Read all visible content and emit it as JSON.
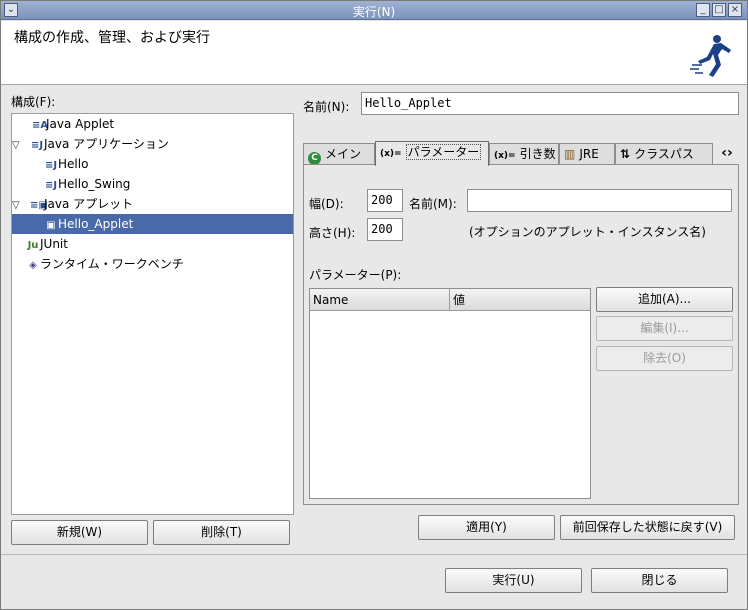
{
  "window": {
    "title": "実行(N)"
  },
  "banner": {
    "heading": "構成の作成、管理、および実行"
  },
  "left": {
    "config_label": "構成(F):",
    "tree": [
      {
        "label": "Java Applet",
        "icon": "applet-config-icon",
        "twisty": "",
        "indent": 0
      },
      {
        "label": "Java アプリケーション",
        "icon": "java-app-icon",
        "twisty": "▽",
        "indent": 0
      },
      {
        "label": "Hello",
        "icon": "java-class-icon",
        "twisty": "",
        "indent": 1
      },
      {
        "label": "Hello_Swing",
        "icon": "java-class-icon",
        "twisty": "",
        "indent": 1
      },
      {
        "label": "Java アプレット",
        "icon": "java-applet-icon",
        "twisty": "▽",
        "indent": 0
      },
      {
        "label": "Hello_Applet",
        "icon": "applet-icon",
        "twisty": "",
        "indent": 1,
        "selected": true
      },
      {
        "label": "JUnit",
        "icon": "junit-icon",
        "twisty": "",
        "indent": 0
      },
      {
        "label": "ランタイム・ワークベンチ",
        "icon": "workbench-icon",
        "twisty": "",
        "indent": 0
      }
    ],
    "new_button": "新規(W)",
    "delete_button": "削除(T)"
  },
  "right": {
    "name_label": "名前(N):",
    "name_value": "Hello_Applet",
    "tabs": [
      {
        "label": "メイン",
        "icon": "main-tab-icon",
        "glyph": "C"
      },
      {
        "label": "パラメーター",
        "icon": "parameters-tab-icon",
        "glyph": "(x)=",
        "active": true
      },
      {
        "label": "引き数",
        "icon": "arguments-tab-icon",
        "glyph": "(x)="
      },
      {
        "label": "JRE",
        "icon": "jre-tab-icon",
        "glyph": "▥"
      },
      {
        "label": "クラスパス",
        "icon": "classpath-tab-icon",
        "glyph": "⇅"
      }
    ],
    "tab_scroll": "‹›",
    "width_label": "幅(D):",
    "width_value": "200",
    "applet_name_label": "名前(M):",
    "applet_name_value": "",
    "height_label": "高さ(H):",
    "height_value": "200",
    "hint": "(オプションのアプレット・インスタンス名)",
    "params_label": "パラメーター(P):",
    "columns": [
      "Name",
      "値"
    ],
    "add_button": "追加(A)...",
    "edit_button": "編集(I)...",
    "remove_button": "除去(O)",
    "apply_button": "適用(Y)",
    "revert_button": "前回保存した状態に戻す(V)"
  },
  "footer": {
    "run_button": "実行(U)",
    "close_button": "閉じる"
  }
}
